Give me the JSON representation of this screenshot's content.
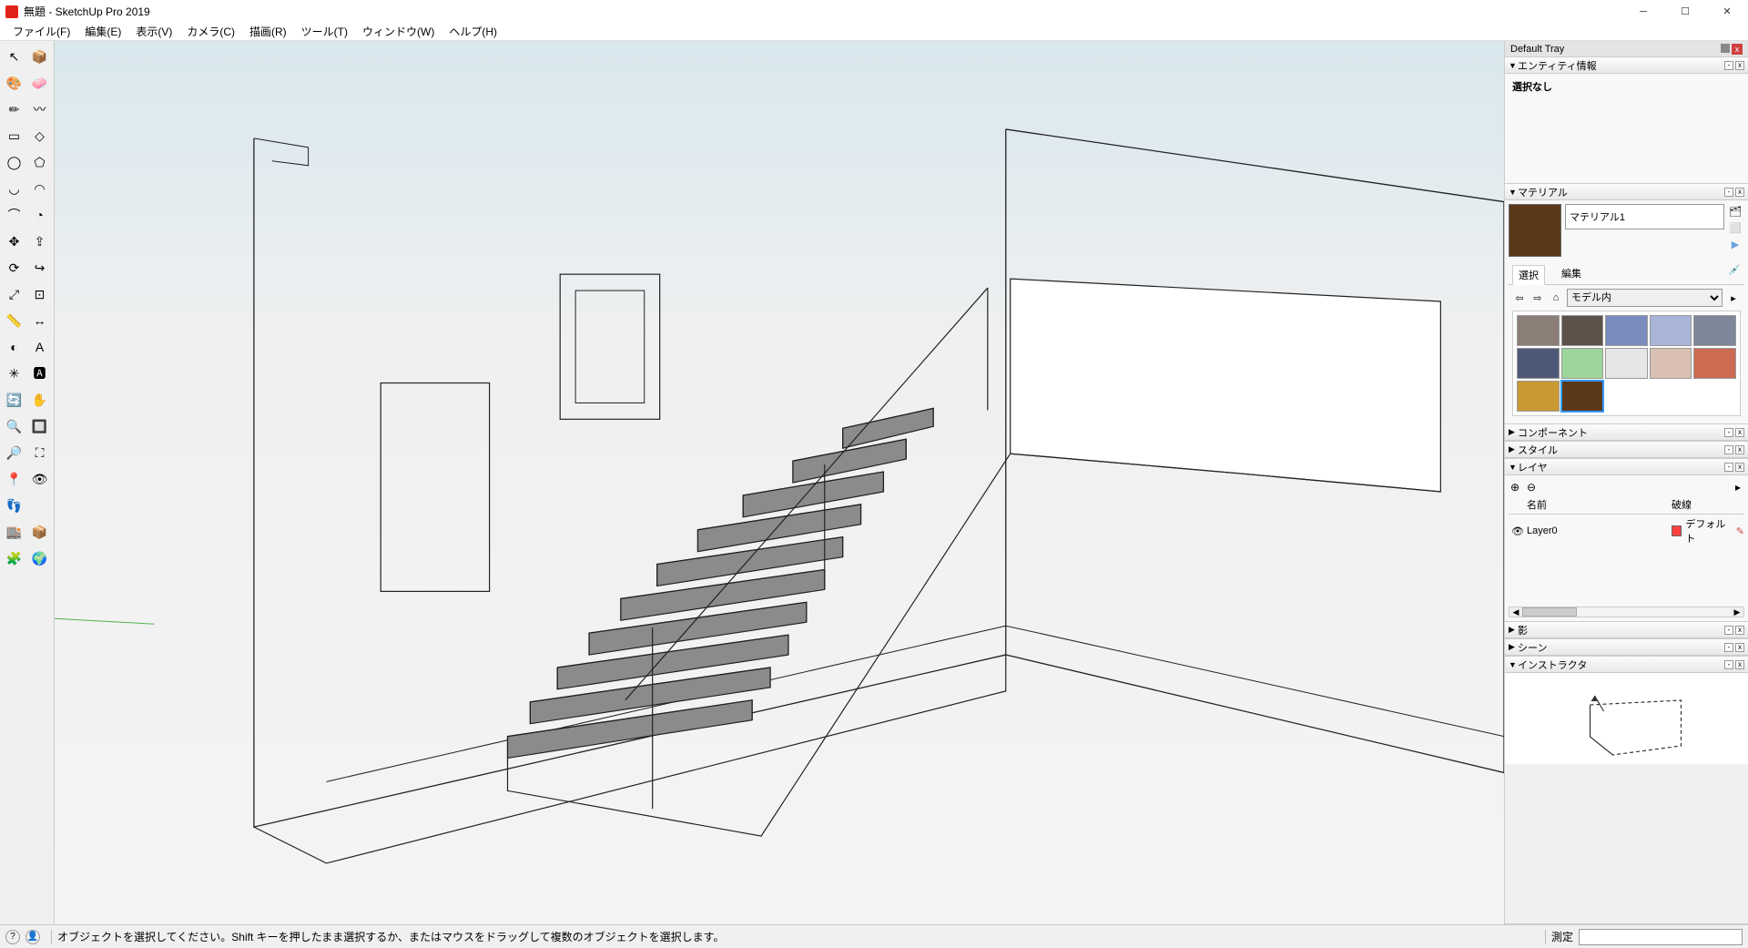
{
  "title": "無題 - SketchUp Pro 2019",
  "menu": [
    "ファイル(F)",
    "編集(E)",
    "表示(V)",
    "カメラ(C)",
    "描画(R)",
    "ツール(T)",
    "ウィンドウ(W)",
    "ヘルプ(H)"
  ],
  "tools": [
    {
      "name": "select-tool",
      "glyph": "↖"
    },
    {
      "name": "component-tool",
      "glyph": "📦"
    },
    {
      "name": "paint-tool",
      "glyph": "🎨"
    },
    {
      "name": "eraser-tool",
      "glyph": "🧼"
    },
    {
      "name": "line-tool",
      "glyph": "✏"
    },
    {
      "name": "freehand-tool",
      "glyph": "〰"
    },
    {
      "name": "rectangle-tool",
      "glyph": "▭"
    },
    {
      "name": "rotated-rect-tool",
      "glyph": "◇"
    },
    {
      "name": "circle-tool",
      "glyph": "◯"
    },
    {
      "name": "polygon-tool",
      "glyph": "⬠"
    },
    {
      "name": "arc-tool",
      "glyph": "◡"
    },
    {
      "name": "arc2-tool",
      "glyph": "◠"
    },
    {
      "name": "arc3-tool",
      "glyph": "⌒"
    },
    {
      "name": "pie-tool",
      "glyph": "◔"
    },
    {
      "name": "move-tool",
      "glyph": "✥"
    },
    {
      "name": "pushpull-tool",
      "glyph": "⇪"
    },
    {
      "name": "rotate-tool",
      "glyph": "⟳"
    },
    {
      "name": "followme-tool",
      "glyph": "↪"
    },
    {
      "name": "scale-tool",
      "glyph": "⤢"
    },
    {
      "name": "offset-tool",
      "glyph": "⊡"
    },
    {
      "name": "tape-tool",
      "glyph": "📏"
    },
    {
      "name": "dimension-tool",
      "glyph": "↔"
    },
    {
      "name": "protractor-tool",
      "glyph": "◐"
    },
    {
      "name": "text-tool",
      "glyph": "A"
    },
    {
      "name": "axes-tool",
      "glyph": "✳"
    },
    {
      "name": "3dtext-tool",
      "glyph": "🅰"
    },
    {
      "name": "orbit-tool",
      "glyph": "🔄"
    },
    {
      "name": "pan-tool",
      "glyph": "✋"
    },
    {
      "name": "zoom-tool",
      "glyph": "🔍"
    },
    {
      "name": "zoomwindow-tool",
      "glyph": "🔲"
    },
    {
      "name": "prev-tool",
      "glyph": "🔎"
    },
    {
      "name": "zoomextents-tool",
      "glyph": "⛶"
    },
    {
      "name": "position-tool",
      "glyph": "📍"
    },
    {
      "name": "lookaround-tool",
      "glyph": "👁"
    },
    {
      "name": "walk-tool",
      "glyph": "👣"
    },
    {
      "name": "section-tool",
      "glyph": ""
    },
    {
      "name": "warehouse-tool",
      "glyph": "🏬"
    },
    {
      "name": "warehouse2-tool",
      "glyph": "📦"
    },
    {
      "name": "extension-tool",
      "glyph": "🧩"
    },
    {
      "name": "geoloc-tool",
      "glyph": "🌍"
    }
  ],
  "tray": {
    "title": "Default Tray",
    "entity": {
      "header": "エンティティ情報",
      "status": "選択なし"
    },
    "materials": {
      "header": "マテリアル",
      "name": "マテリアル1",
      "tabs": {
        "select": "選択",
        "edit": "編集"
      },
      "dropdown": "モデル内",
      "swatches": [
        "#8a7e76",
        "#5c5249",
        "#7a8bbd",
        "#aab4d9",
        "#7e8699",
        "#4d5a77",
        "#9dd49a",
        "#e6e6e6",
        "#d9c0b3",
        "#cc6b52",
        "#c99a33",
        "#5b3817"
      ],
      "selected_index": 11
    },
    "components": {
      "header": "コンポーネント"
    },
    "styles": {
      "header": "スタイル"
    },
    "layers": {
      "header": "レイヤ",
      "cols": {
        "name": "名前",
        "dash": "破線"
      },
      "rows": [
        {
          "name": "Layer0",
          "dash": "デフォルト"
        }
      ]
    },
    "shadows": {
      "header": "影"
    },
    "scenes": {
      "header": "シーン"
    },
    "instructor": {
      "header": "インストラクタ"
    }
  },
  "status": {
    "hint": "オブジェクトを選択してください。Shift キーを押したまま選択するか、またはマウスをドラッグして複数のオブジェクトを選択します。",
    "measure_label": "測定"
  }
}
